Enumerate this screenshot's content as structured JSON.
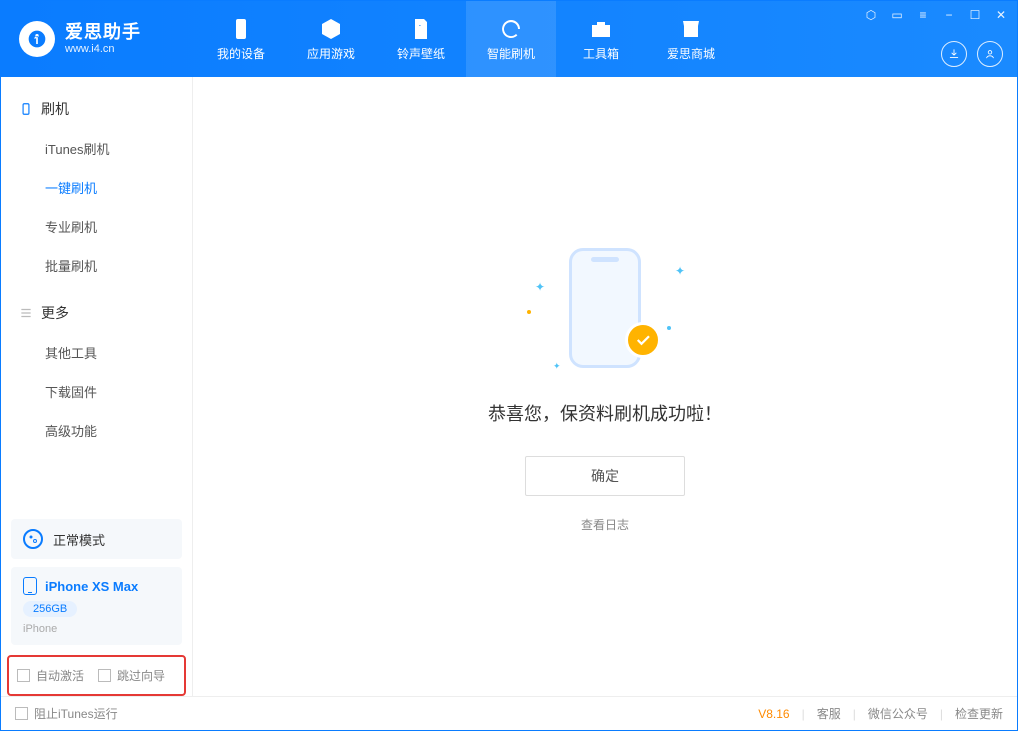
{
  "app": {
    "title": "爱思助手",
    "subtitle": "www.i4.cn"
  },
  "nav": {
    "items": [
      {
        "label": "我的设备"
      },
      {
        "label": "应用游戏"
      },
      {
        "label": "铃声壁纸"
      },
      {
        "label": "智能刷机"
      },
      {
        "label": "工具箱"
      },
      {
        "label": "爱思商城"
      }
    ]
  },
  "sidebar": {
    "section1": {
      "title": "刷机",
      "items": [
        {
          "label": "iTunes刷机"
        },
        {
          "label": "一键刷机"
        },
        {
          "label": "专业刷机"
        },
        {
          "label": "批量刷机"
        }
      ]
    },
    "section2": {
      "title": "更多",
      "items": [
        {
          "label": "其他工具"
        },
        {
          "label": "下载固件"
        },
        {
          "label": "高级功能"
        }
      ]
    },
    "mode": {
      "label": "正常模式"
    },
    "device": {
      "name": "iPhone XS Max",
      "capacity": "256GB",
      "type": "iPhone"
    },
    "options": {
      "auto_activate": "自动激活",
      "skip_wizard": "跳过向导"
    }
  },
  "main": {
    "success_text": "恭喜您，保资料刷机成功啦！",
    "ok_button": "确定",
    "view_log": "查看日志"
  },
  "footer": {
    "block_itunes": "阻止iTunes运行",
    "version": "V8.16",
    "support": "客服",
    "wechat": "微信公众号",
    "check_update": "检查更新"
  }
}
